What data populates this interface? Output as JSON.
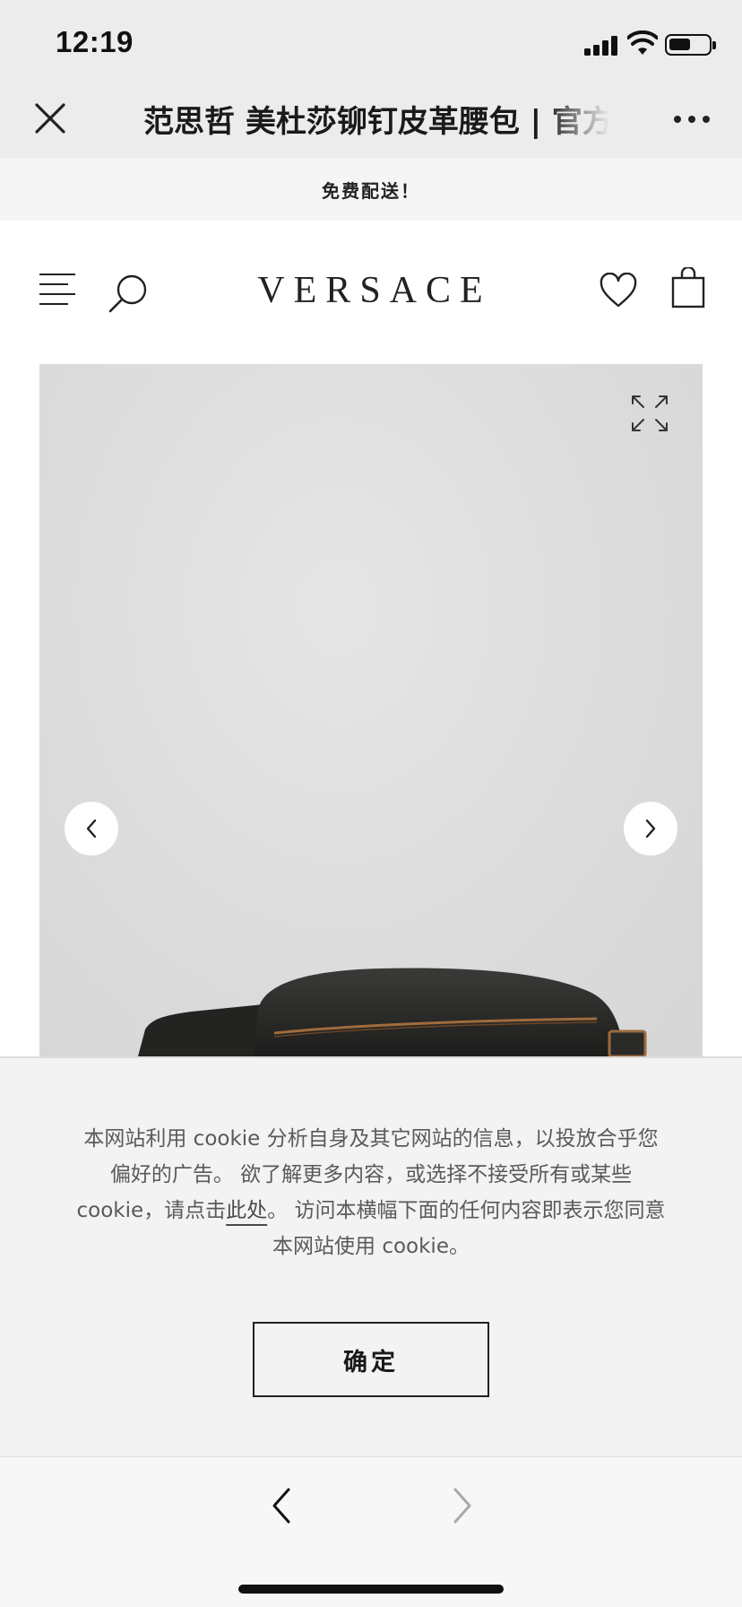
{
  "status_bar": {
    "time": "12:19",
    "battery_level": 0.55
  },
  "title_bar": {
    "title": "范思哲 美杜莎铆钉皮革腰包 | 官方",
    "close_icon": "close-icon",
    "more_icon": "more-dots-icon"
  },
  "promo": {
    "text": "免费配送！"
  },
  "site_header": {
    "logo": "VERSACE",
    "icons": [
      "menu-icon",
      "search-icon",
      "heart-icon",
      "shopping-bag-icon"
    ]
  },
  "gallery": {
    "icons": [
      "expand-icon",
      "chevron-left-icon",
      "chevron-right-icon"
    ]
  },
  "cookie_banner": {
    "text_before": "本网站利用 cookie 分析自身及其它网站的信息，以投放合乎您偏好的广告。 欲了解更多内容，或选择不接受所有或某些cookie，请点击",
    "link_text": "此处",
    "text_after": "。 访问本横幅下面的任何内容即表示您同意本网站使用 cookie。",
    "confirm_label": "确定"
  },
  "bottom_bar": {
    "icons": [
      "back-arrow-icon",
      "forward-arrow-icon"
    ]
  },
  "colors": {
    "top_bar_bg": "#ececec",
    "promo_bg": "#f5f5f5",
    "gallery_bg": "#dcdcdc",
    "cookie_bg": "#f3f3f3",
    "text_dark": "#1a1a1a"
  }
}
